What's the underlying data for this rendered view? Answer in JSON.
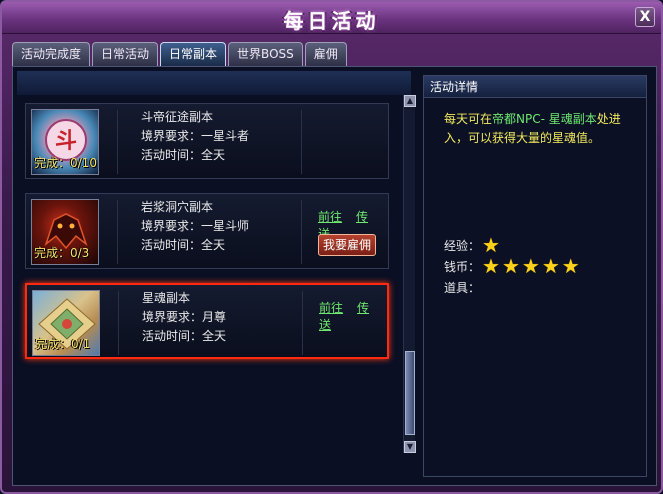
{
  "window": {
    "title": "每日活动",
    "close_label": "X"
  },
  "tabs": [
    {
      "label": "活动完成度",
      "active": false
    },
    {
      "label": "日常活动",
      "active": false
    },
    {
      "label": "日常副本",
      "active": true
    },
    {
      "label": "世界BOSS",
      "active": false
    },
    {
      "label": "雇佣",
      "active": false
    }
  ],
  "dungeons": [
    {
      "name": "斗帝征途副本",
      "realm": "境界要求：一星斗者",
      "time": "活动时间：全天",
      "progress": "完成：0/10",
      "thumb_glyph": "斗",
      "actions": [],
      "hire_label": ""
    },
    {
      "name": "岩浆洞穴副本",
      "realm": "境界要求：一星斗师",
      "time": "活动时间：全天",
      "progress": "完成：0/3",
      "actions": [
        "前往",
        "传送"
      ],
      "hire_label": "我要雇佣"
    },
    {
      "name": "星魂副本",
      "realm": "境界要求：月尊",
      "time": "活动时间：全天",
      "progress": "完成：0/1",
      "actions": [
        "前往",
        "传送"
      ],
      "hire_label": "",
      "selected": true
    }
  ],
  "detail": {
    "header": "活动详情",
    "desc_prefix": "每天可在",
    "desc_highlight": "帝都NPC- 星魂副本",
    "desc_suffix": "处进入，可以获得大量的星魂值。",
    "rewards": [
      {
        "label": "经验：",
        "stars": 1
      },
      {
        "label": "钱币：",
        "stars": 5
      },
      {
        "label": "道具：",
        "stars": 0
      }
    ]
  },
  "colors": {
    "accent_green": "#6fe86f",
    "desc_yellow": "#f1ea5e",
    "selected_border": "#ff2a10",
    "star": "#ffd21a"
  }
}
